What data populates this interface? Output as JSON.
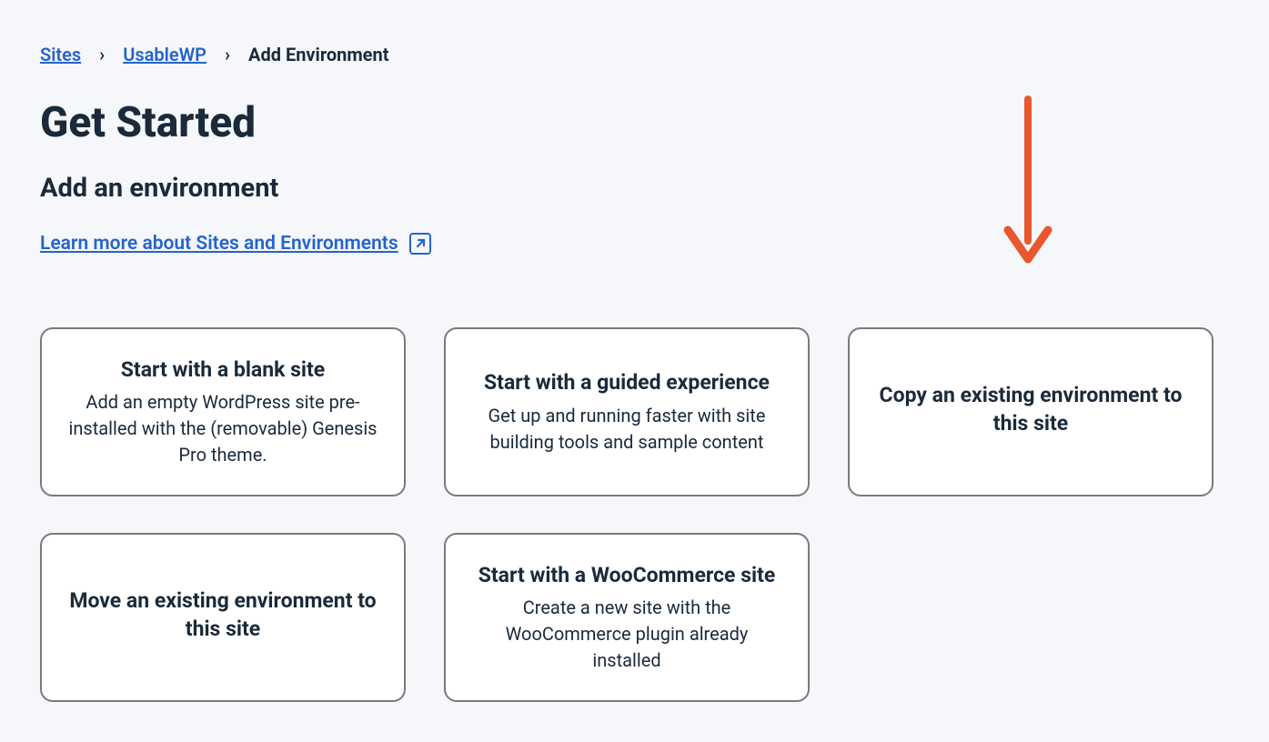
{
  "breadcrumb": {
    "items": [
      "Sites",
      "UsableWP"
    ],
    "current": "Add Environment"
  },
  "page": {
    "title": "Get Started",
    "subtitle": "Add an environment",
    "learn_more": "Learn more about Sites and Environments"
  },
  "cards": [
    {
      "title": "Start with a blank site",
      "desc": "Add an empty WordPress site pre-installed with the (removable) Genesis Pro theme."
    },
    {
      "title": "Start with a guided experience",
      "desc": "Get up and running faster with site building tools and sample content"
    },
    {
      "title": "Copy an existing environment to this site",
      "desc": ""
    },
    {
      "title": "Move an existing environment to this site",
      "desc": ""
    },
    {
      "title": "Start with a WooCommerce site",
      "desc": "Create a new site with the WooCommerce plugin already installed"
    }
  ]
}
